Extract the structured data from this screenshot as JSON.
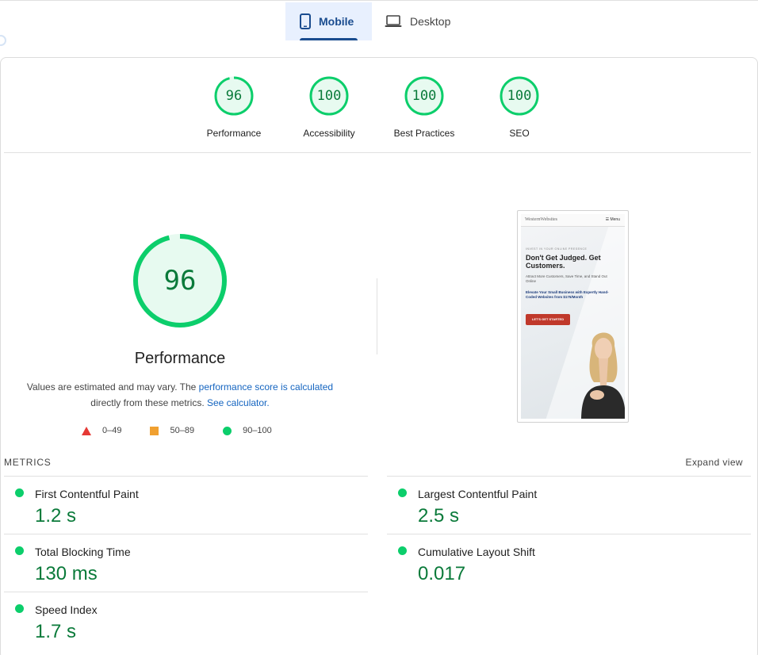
{
  "tabs": [
    {
      "label": "Mobile",
      "icon": "phone-icon",
      "active": true
    },
    {
      "label": "Desktop",
      "icon": "laptop-icon",
      "active": false
    }
  ],
  "colors": {
    "pass": "#0cce6b",
    "pass_text": "#0a7a3a",
    "average": "#f0a030",
    "fail": "#e53935",
    "link": "#1565c0",
    "tab_active_bg": "#e8f0fe"
  },
  "categories": [
    {
      "score": "96",
      "label": "Performance",
      "value": 0.96
    },
    {
      "score": "100",
      "label": "Accessibility",
      "value": 1.0
    },
    {
      "score": "100",
      "label": "Best Practices",
      "value": 1.0
    },
    {
      "score": "100",
      "label": "SEO",
      "value": 1.0
    }
  ],
  "performance": {
    "score": "96",
    "value": 0.96,
    "title": "Performance",
    "desc_prefix": "Values are estimated and may vary. The ",
    "desc_link1": "performance score is calculated",
    "desc_middle": "directly from these metrics.",
    "desc_link2": "See calculator.",
    "legend": [
      {
        "shape": "triangle",
        "label": "0–49"
      },
      {
        "shape": "square",
        "label": "50–89"
      },
      {
        "shape": "circle",
        "label": "90–100"
      }
    ]
  },
  "screenshot": {
    "logo": "WesternWebsites",
    "menu": "☰ Menu",
    "kicker": "INVEST IN YOUR ONLINE PRESENCE",
    "headline": "Don't Get Judged. Get Customers.",
    "sub": "Attract More Customers, Save Time, and Stand Out Online",
    "blue": "Elevate Your Small Business with Expertly Hand-Coded Websites from $175/Month",
    "button": "LET'S GET STARTED"
  },
  "metrics": {
    "title": "METRICS",
    "expand": "Expand view",
    "items": [
      {
        "name": "First Contentful Paint",
        "value": "1.2 s"
      },
      {
        "name": "Largest Contentful Paint",
        "value": "2.5 s"
      },
      {
        "name": "Total Blocking Time",
        "value": "130 ms"
      },
      {
        "name": "Cumulative Layout Shift",
        "value": "0.017"
      },
      {
        "name": "Speed Index",
        "value": "1.7 s"
      }
    ]
  }
}
